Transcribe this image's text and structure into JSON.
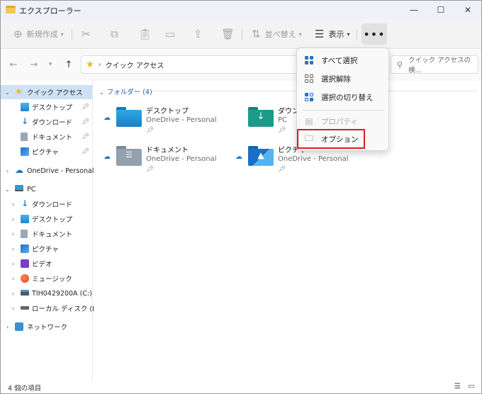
{
  "window": {
    "title": "エクスプローラー",
    "controls": [
      "—",
      "☐",
      "✕"
    ]
  },
  "toolbar": {
    "new_label": "新規作成",
    "sort_label": "並べ替え",
    "view_label": "表示",
    "more_label": "•••"
  },
  "address": {
    "path": "クイック アクセス",
    "search_placeholder": "クイック アクセスの検..."
  },
  "sidebar": {
    "quick_access": "クイック アクセス",
    "qa_items": [
      "デスクトップ",
      "ダウンロード",
      "ドキュメント",
      "ピクチャ"
    ],
    "onedrive": "OneDrive - Personal",
    "pc": "PC",
    "pc_items": [
      "ダウンロード",
      "デスクトップ",
      "ドキュメント",
      "ピクチャ",
      "ビデオ",
      "ミュージック",
      "TIH0429200A (C:)",
      "ローカル ディスク (D:)"
    ],
    "network": "ネットワーク"
  },
  "main": {
    "group_header": "フォルダー (4)",
    "folders": [
      {
        "name": "デスクトップ",
        "location": "OneDrive - Personal"
      },
      {
        "name": "ダウンロ",
        "location": "PC"
      },
      {
        "name": "ドキュメント",
        "location": "OneDrive - Personal"
      },
      {
        "name": "ピクチャ",
        "location": "OneDrive - Personal"
      }
    ]
  },
  "menu": {
    "select_all": "すべて選択",
    "deselect": "選択解除",
    "invert": "選択の切り替え",
    "properties": "プロパティ",
    "options": "オプション"
  },
  "statusbar": {
    "count": "4 個の項目"
  },
  "colors": {
    "accent": "#2a73c5",
    "highlight": "#d81e1e",
    "folder_blue": "#1f86c9",
    "folder_green": "#1e9a8a"
  }
}
